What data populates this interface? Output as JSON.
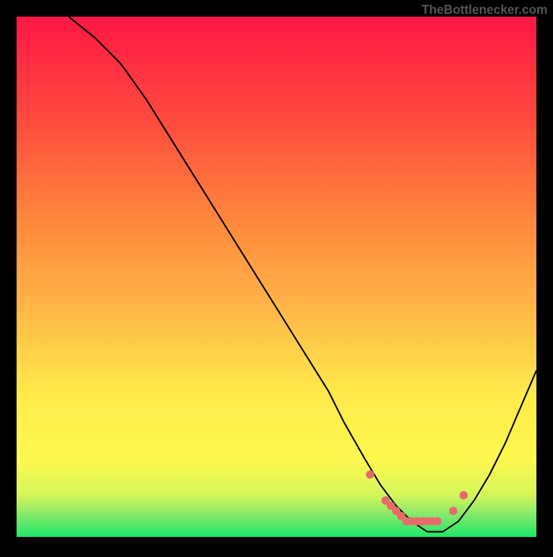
{
  "watermark": "TheBottlenecker.com",
  "chart_data": {
    "type": "line",
    "title": "",
    "xlabel": "",
    "ylabel": "",
    "xlim": [
      0,
      100
    ],
    "ylim": [
      0,
      100
    ],
    "series": [
      {
        "name": "bottleneck-curve",
        "x": [
          10,
          15,
          20,
          25,
          30,
          35,
          40,
          45,
          50,
          55,
          60,
          63,
          67,
          70,
          73,
          76,
          79,
          82,
          85,
          88,
          91,
          94,
          97,
          100
        ],
        "y": [
          100,
          96,
          91,
          84,
          76,
          68,
          60,
          52,
          44,
          36,
          28,
          22,
          15,
          10,
          6,
          3,
          1,
          1,
          3,
          7,
          12,
          18,
          25,
          32
        ]
      }
    ],
    "markers": {
      "name": "optimal-range-markers",
      "x": [
        68,
        71,
        72,
        73,
        74,
        75,
        76,
        77,
        78,
        79,
        80,
        81,
        84,
        86
      ],
      "y": [
        12,
        7,
        6,
        5,
        4,
        3,
        3,
        3,
        3,
        3,
        3,
        3,
        5,
        8
      ]
    },
    "gradient_stops": [
      {
        "offset": 0,
        "color": "#ff1744"
      },
      {
        "offset": 20,
        "color": "#ff4b3e"
      },
      {
        "offset": 40,
        "color": "#ff8a3d"
      },
      {
        "offset": 55,
        "color": "#ffb347"
      },
      {
        "offset": 72,
        "color": "#ffe94a"
      },
      {
        "offset": 85,
        "color": "#fff94f"
      },
      {
        "offset": 92,
        "color": "#d4f55a"
      },
      {
        "offset": 96,
        "color": "#7ee86b"
      },
      {
        "offset": 100,
        "color": "#1de866"
      }
    ]
  }
}
